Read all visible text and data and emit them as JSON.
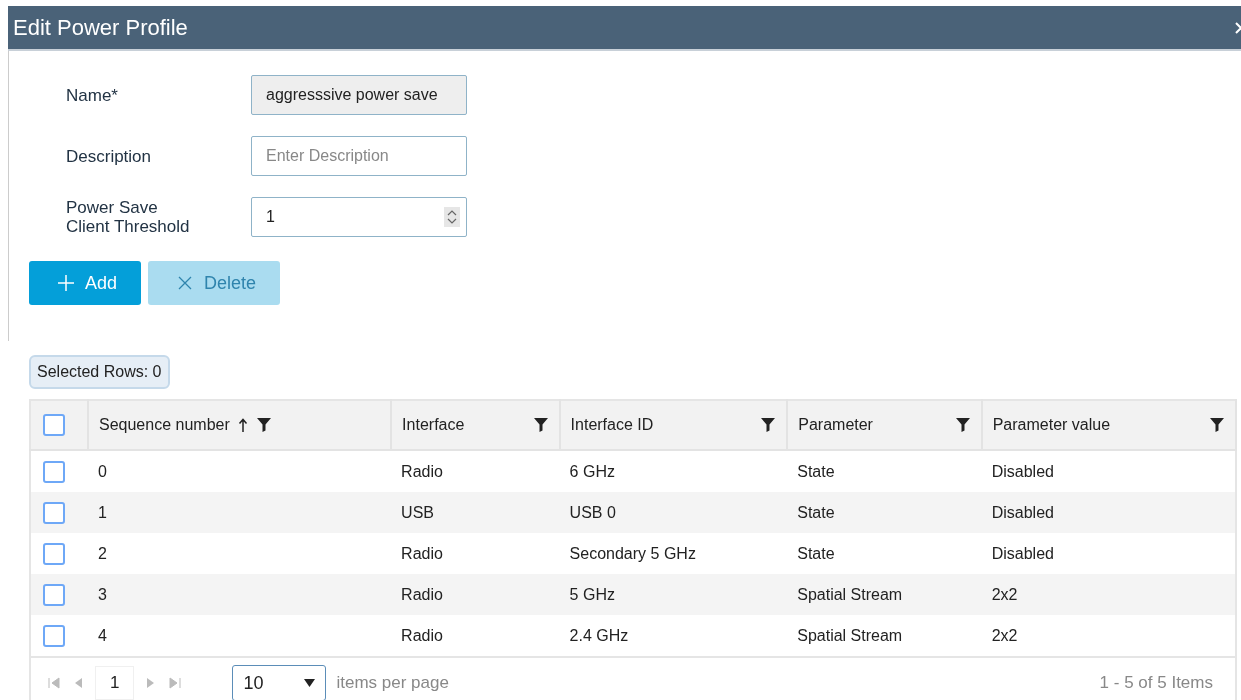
{
  "window": {
    "title": "Edit Power Profile"
  },
  "form": [
    {
      "label": "Name*",
      "kind": "text",
      "value": "aggresssive power save",
      "disabled": true
    },
    {
      "label": "Description",
      "kind": "text",
      "placeholder": "Enter Description",
      "disabled": false
    },
    {
      "label": "Power Save Client Threshold",
      "kind": "number",
      "value": "1",
      "disabled": false
    }
  ],
  "buttons": [
    {
      "label": "Add",
      "kind": "add",
      "disabled": false
    },
    {
      "label": "Delete",
      "kind": "delete",
      "disabled": true
    }
  ],
  "selected_rows": "Selected Rows: 0",
  "table": {
    "all_checked": false,
    "columns": [
      {
        "label": "Sequence number",
        "sorted": true
      },
      {
        "label": "Interface",
        "sorted": false
      },
      {
        "label": "Interface ID",
        "sorted": false
      },
      {
        "label": "Parameter",
        "sorted": false
      },
      {
        "label": "Parameter value",
        "sorted": false
      }
    ],
    "rows": [
      {
        "checked": false,
        "cells": [
          "0",
          "Radio",
          "6 GHz",
          "State",
          "Disabled"
        ]
      },
      {
        "checked": false,
        "cells": [
          "1",
          "USB",
          "USB 0",
          "State",
          "Disabled"
        ]
      },
      {
        "checked": false,
        "cells": [
          "2",
          "Radio",
          "Secondary 5 GHz",
          "State",
          "Disabled"
        ]
      },
      {
        "checked": false,
        "cells": [
          "3",
          "Radio",
          "5 GHz",
          "Spatial Stream",
          "2x2"
        ]
      },
      {
        "checked": false,
        "cells": [
          "4",
          "Radio",
          "2.4 GHz",
          "Spatial Stream",
          "2x2"
        ]
      }
    ]
  },
  "pager": {
    "page": "1",
    "page_size": "10",
    "page_size_label": "items per page",
    "summary": "1 - 5 of 5 Items"
  }
}
